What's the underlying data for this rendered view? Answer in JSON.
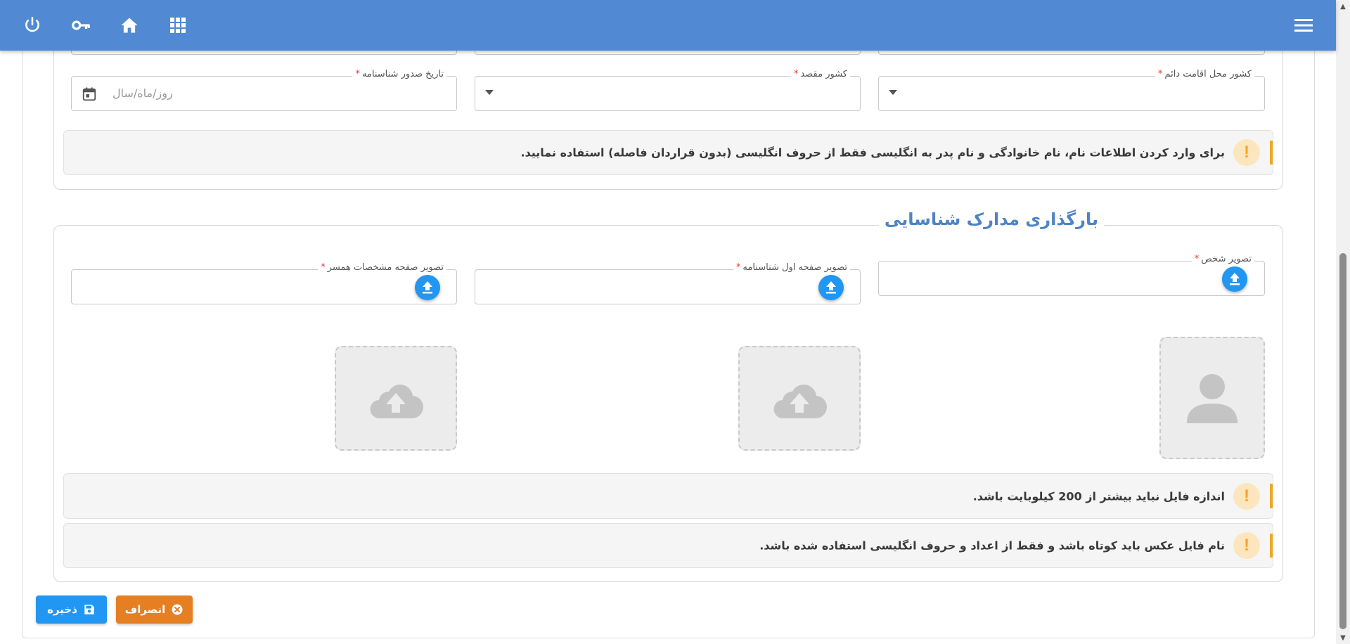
{
  "topbar": {
    "icons": [
      "power-icon",
      "key-icon",
      "home-icon",
      "apps-grid-icon",
      "menu-icon"
    ],
    "background": "#5189d3"
  },
  "form": {
    "issue_date": {
      "label": "تاریخ صدور شناسنامه",
      "placeholder": "روز/ماه/سال"
    },
    "destination_country": {
      "label": "کشور مقصد",
      "value": ""
    },
    "residence_country": {
      "label": "کشور محل اقامت دائم",
      "value": ""
    },
    "required_mark": "*"
  },
  "alerts": {
    "english_names": "برای وارد کردن اطلاعات نام، نام خانوادگی و نام پدر به انگلیسی فقط از حروف انگلیسی (بدون قراردان فاصله) استفاده نمایید.",
    "file_size": "اندازه فایل نباید بیشتر از 200 کیلوبایت باشد.",
    "file_name": "نام فایل عکس باید کوتاه باشد و فقط از اعداد و حروف انگلیسی استفاده شده باشد.",
    "warning_symbol": "!"
  },
  "uploads": {
    "section_title": "بارگذاری مدارک شناسایی",
    "person_photo": {
      "label": "تصویر شخص"
    },
    "id_first_page": {
      "label": "تصویر صفحه اول شناسنامه"
    },
    "spouse_page": {
      "label": "تصویر صفحه مشخصات همسر"
    }
  },
  "actions": {
    "save_label": "ذخیره",
    "cancel_label": "انصراف",
    "save_color": "#2196f3",
    "cancel_color": "#e67e22"
  },
  "colors": {
    "accent": "#4e84c5",
    "warning": "#f0a820",
    "required": "#e53935"
  }
}
